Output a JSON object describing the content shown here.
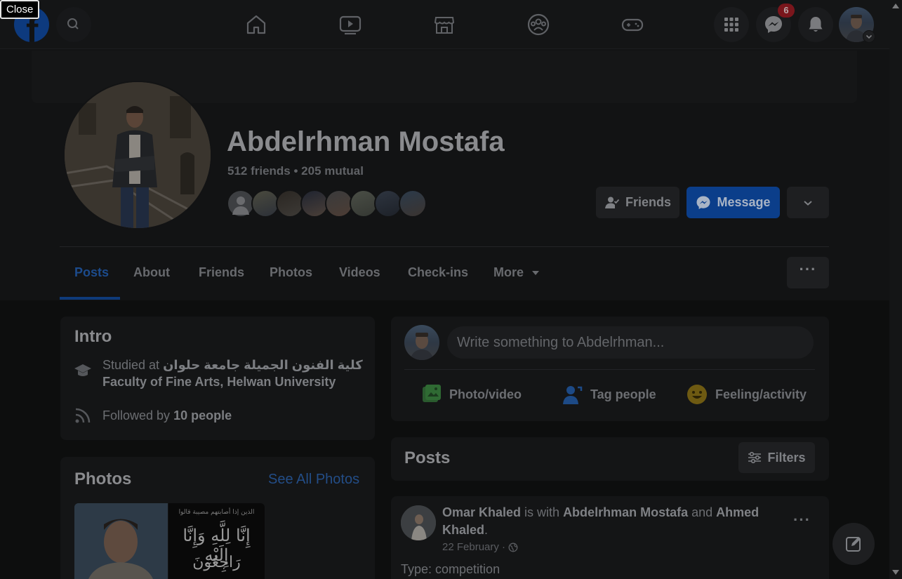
{
  "overlay": {
    "close_label": "Close"
  },
  "topbar": {
    "logo_letter": "f",
    "messenger_badge": "6"
  },
  "profile": {
    "name": "Abdelrhman Mostafa",
    "friends_count": "512 friends • 205 mutual",
    "buttons": {
      "friends": "Friends",
      "message": "Message"
    }
  },
  "tabs": [
    {
      "label": "Posts"
    },
    {
      "label": "About"
    },
    {
      "label": "Friends"
    },
    {
      "label": "Photos"
    },
    {
      "label": "Videos"
    },
    {
      "label": "Check-ins"
    },
    {
      "label": "More"
    }
  ],
  "tab_more_dots": "···",
  "intro": {
    "title": "Intro",
    "studied_prefix": "Studied at ",
    "studied_arabic": "كلية الفنون الجميلة جامعة حلوان",
    "studied_english": "Faculty of Fine Arts, Helwan University",
    "followed_prefix": "Followed by ",
    "followed_count": "10 people"
  },
  "photos_card": {
    "title": "Photos",
    "see_all": "See All Photos",
    "photo2_lines": [
      "الذين إذا أصابتهم مصيبة قالوا",
      "إِنَّا لِلَّهِ وَإِنَّا إِلَيْهِ",
      "رَاجِعُونَ"
    ]
  },
  "composer": {
    "placeholder": "Write something to Abdelrhman...",
    "actions": {
      "photo": "Photo/video",
      "tag": "Tag people",
      "feeling": "Feeling/activity"
    }
  },
  "posts_header": {
    "title": "Posts",
    "filters": "Filters"
  },
  "post": {
    "author": "Omar Khaled",
    "with_text": " is with ",
    "tagged1": "Abdelrhman Mostafa",
    "and_text": " and ",
    "tagged2": "Ahmed Khaled",
    "period": ".",
    "date": "22 February · ",
    "body": "Type: competition",
    "dots": "···"
  },
  "colors": {
    "accent_blue": "#0b3e8a",
    "link_blue": "#234d87",
    "badge_red": "#7a161c"
  }
}
